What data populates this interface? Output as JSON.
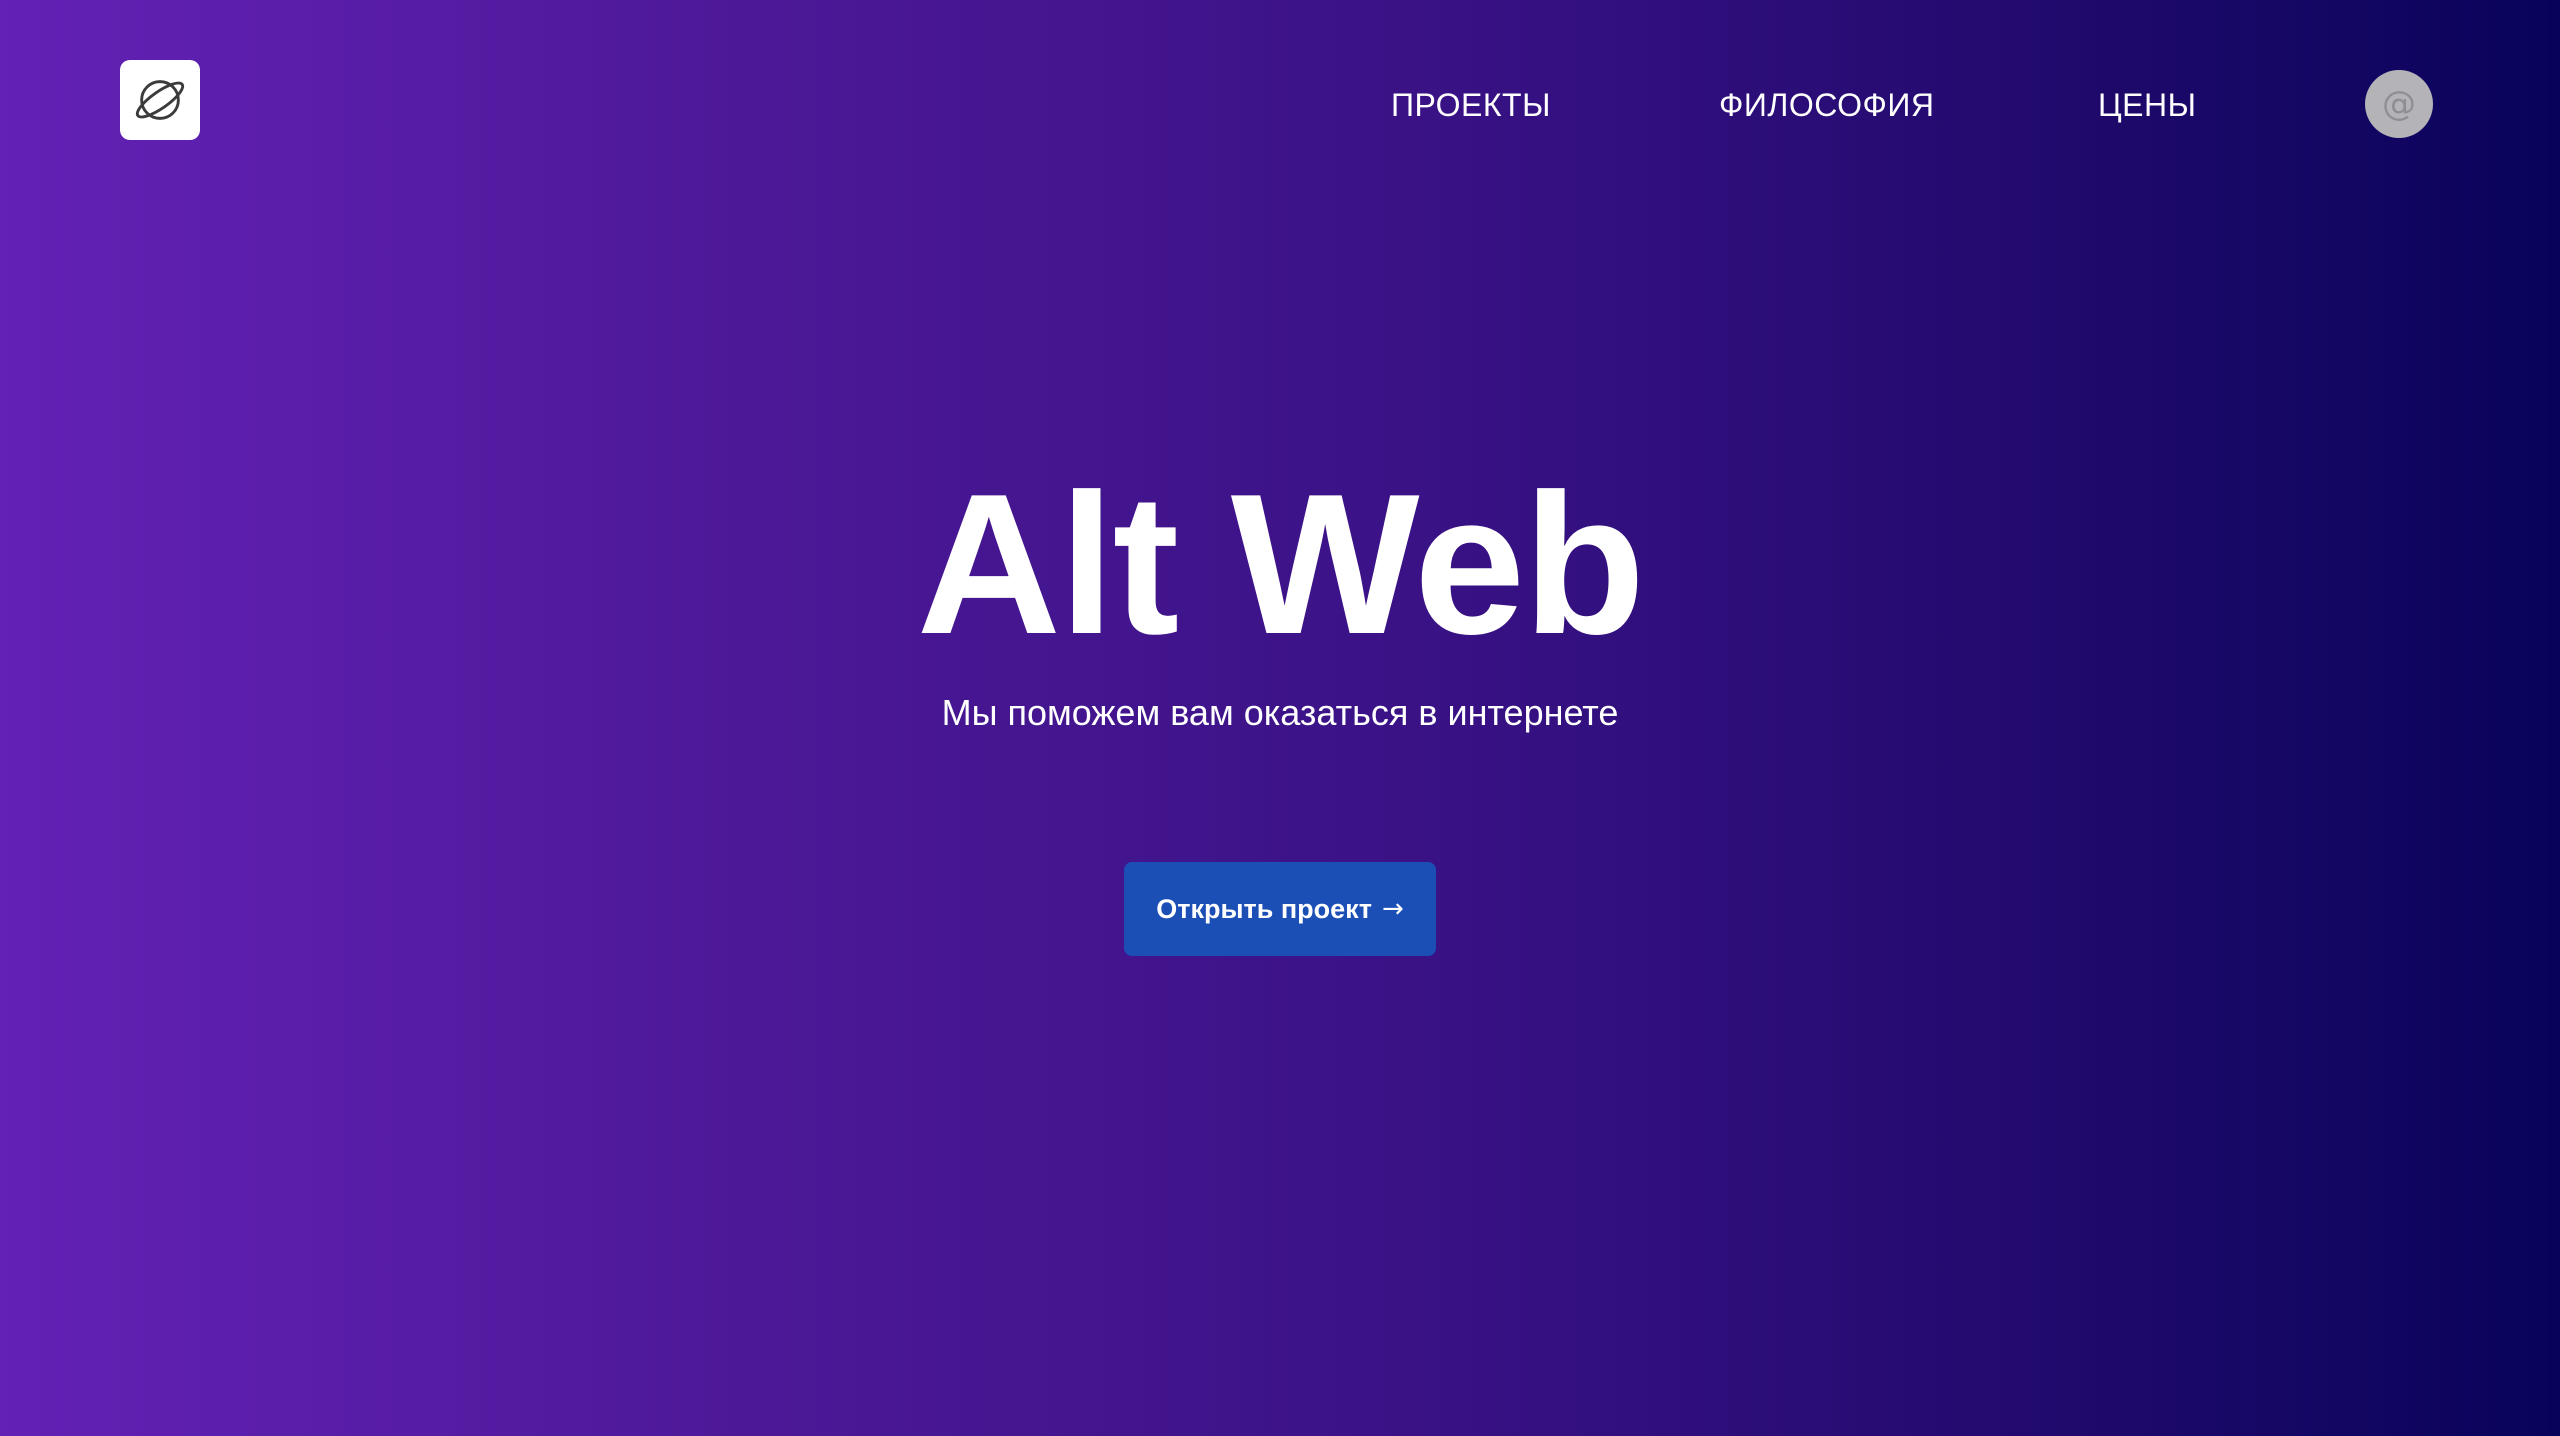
{
  "header": {
    "logo_icon": "planet-icon",
    "nav": [
      {
        "label": "ПРОЕКТЫ"
      },
      {
        "label": "ФИЛОСОФИЯ"
      },
      {
        "label": "ЦЕНЫ"
      }
    ],
    "contact_icon": "at-sign-icon",
    "contact_glyph": "@"
  },
  "hero": {
    "title": "Alt Web",
    "subtitle": "Мы поможем вам оказаться в интернете",
    "cta_label": "Открыть проект",
    "cta_arrow": "→"
  },
  "colors": {
    "gradient_start": "#6321b5",
    "gradient_end": "#08035a",
    "cta_background": "#1b4fb6",
    "contact_background": "#b4b4b8"
  }
}
